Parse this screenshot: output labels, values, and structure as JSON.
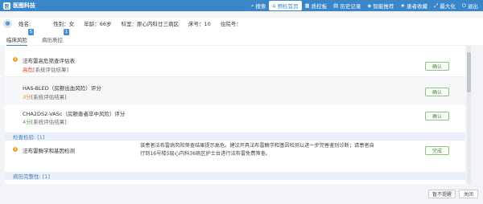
{
  "app": {
    "title": "医图科技"
  },
  "topnav": [
    {
      "label": "搜索",
      "icon": "search-icon",
      "glyph": "⌕",
      "active": false
    },
    {
      "label": "预检首页",
      "icon": "home-icon",
      "glyph": "⌂",
      "active": true
    },
    {
      "label": "质控板",
      "icon": "board-icon",
      "glyph": "▦",
      "active": false
    },
    {
      "label": "历史记录",
      "icon": "history-icon",
      "glyph": "▤",
      "active": false
    },
    {
      "label": "智能推荐",
      "icon": "recommend-icon",
      "glyph": "◈",
      "active": false
    },
    {
      "label": "患者收藏",
      "icon": "star-icon",
      "glyph": "★",
      "active": false
    },
    {
      "label": "最大化",
      "icon": "maximize-icon",
      "glyph": "⤢",
      "active": false
    },
    {
      "label": "退出",
      "icon": "exit-icon",
      "glyph": "⏻",
      "active": false
    }
  ],
  "patient": {
    "name_label": "姓名:",
    "gender": "性别：女",
    "age": "年龄：66岁",
    "dept": "科室：原心内科廿三病区",
    "bed": "床号：10",
    "admission": "住院号："
  },
  "tabs": [
    {
      "label": "临床风险",
      "badge": "5",
      "active": true
    },
    {
      "label": "病历质控",
      "badge": "1",
      "active": false
    }
  ],
  "risk_items": [
    {
      "title": "法布雷高危筛查评估表",
      "result": "高危",
      "result_color": "red",
      "sub": "",
      "button": "确认",
      "warn": true
    },
    {
      "title": "HAS-BLED（房颤出血风险）评分",
      "result": "3分",
      "result_color": "orange",
      "sub": "[系统评估结果]",
      "button": "确认",
      "warn": false
    },
    {
      "title": "CHA2DS2-VASc（房颤患者卒中风险）评分",
      "result": "4分",
      "result_color": "green",
      "sub": "[系统评估结果]",
      "button": "确认",
      "warn": false
    }
  ],
  "first_sub": "[系统评估结果]",
  "exam": {
    "header": "检查检验:  [1]",
    "title": "法布雷酶学和基因检测",
    "description_lines": [
      "该患者法布雷病风险筛查结果提示高危。建议开具法布雷酶学和基因检测以进一步完善鉴别诊断；请患者自",
      "行到16号楼5层心内科36病区护士台进行法布雷免费筛查。"
    ],
    "button": "完成"
  },
  "quality": {
    "header": "病历完整性:  [1]"
  },
  "footer": {
    "dismiss": "暂不提醒",
    "close": "关闭"
  }
}
